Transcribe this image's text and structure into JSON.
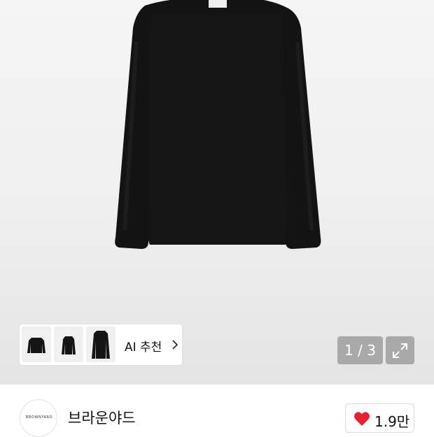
{
  "product": {
    "image_alt": "black long sleeve t-shirt",
    "image_index": "1 / 3"
  },
  "ai_recommend": {
    "thumbnails": [
      "black long sleeve t-shirt front",
      "black long sleeve t-shirt fitted",
      "black long sleeve t-shirt side"
    ],
    "label": "AI 추천"
  },
  "brand": {
    "logo_text": "BROWNYARD",
    "name": "브라운야드"
  },
  "like": {
    "count": "1.9만"
  },
  "colors": {
    "heart": "#e8202f",
    "overlay_button": "#a9a9a9",
    "garment": "#131313"
  },
  "icons": {
    "expand": "expand-arrows-icon",
    "chevron": "chevron-right-icon",
    "heart": "heart-icon"
  }
}
